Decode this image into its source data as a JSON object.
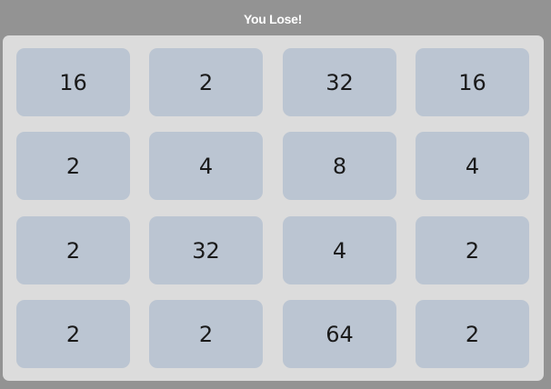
{
  "status": "You Lose!",
  "grid": [
    [
      "16",
      "2",
      "32",
      "16"
    ],
    [
      "2",
      "4",
      "8",
      "4"
    ],
    [
      "2",
      "32",
      "4",
      "2"
    ],
    [
      "2",
      "2",
      "64",
      "2"
    ]
  ],
  "colors": {
    "page_background": "#939393",
    "board_background": "#dcdcdc",
    "tile_background": "#bbc5d2",
    "tile_text": "#1a1a1a",
    "status_text": "#ffffff"
  }
}
